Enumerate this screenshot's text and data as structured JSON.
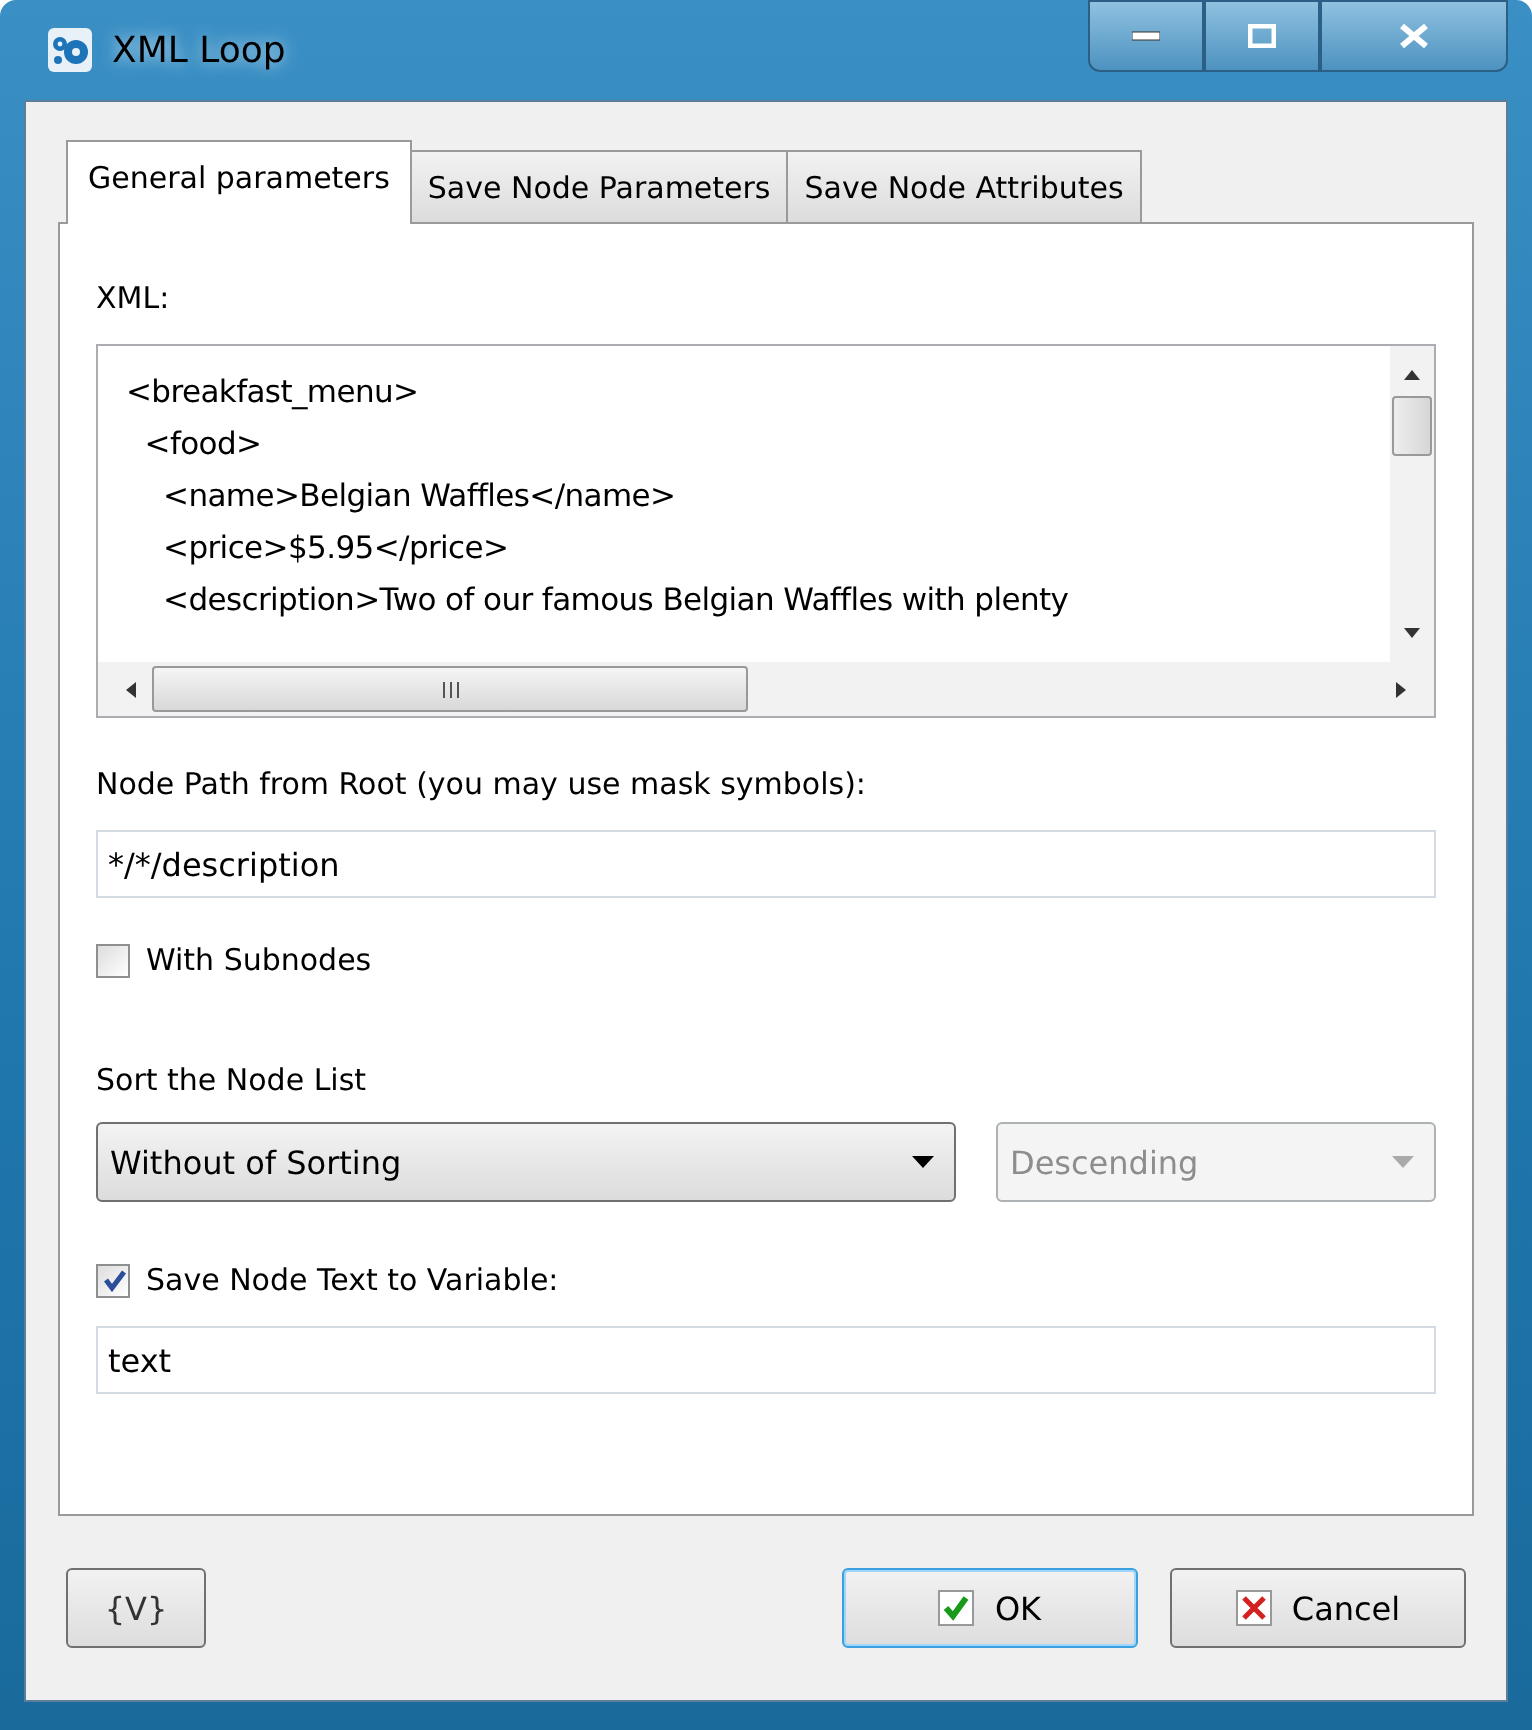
{
  "window": {
    "title": "XML Loop"
  },
  "tabs": [
    {
      "label": "General parameters",
      "selected": true
    },
    {
      "label": "Save Node Parameters",
      "selected": false
    },
    {
      "label": "Save Node Attributes",
      "selected": false
    }
  ],
  "xml": {
    "label": "XML:",
    "lines": [
      "<breakfast_menu>",
      "  <food>",
      "    <name>Belgian Waffles</name>",
      "    <price>$5.95</price>",
      "    <description>Two of our famous Belgian Waffles with plenty"
    ]
  },
  "node_path": {
    "label": "Node Path from Root (you may use mask symbols):",
    "value": "*/*/description"
  },
  "with_subnodes": {
    "label": "With Subnodes",
    "checked": false
  },
  "sort": {
    "label": "Sort the Node List",
    "field": {
      "value": "Without of Sorting",
      "disabled": false
    },
    "order": {
      "value": "Descending",
      "disabled": true
    }
  },
  "save_text": {
    "label": "Save Node Text to Variable:",
    "checked": true,
    "value": "text"
  },
  "buttons": {
    "variables": "{V}",
    "ok": "OK",
    "cancel": "Cancel"
  }
}
